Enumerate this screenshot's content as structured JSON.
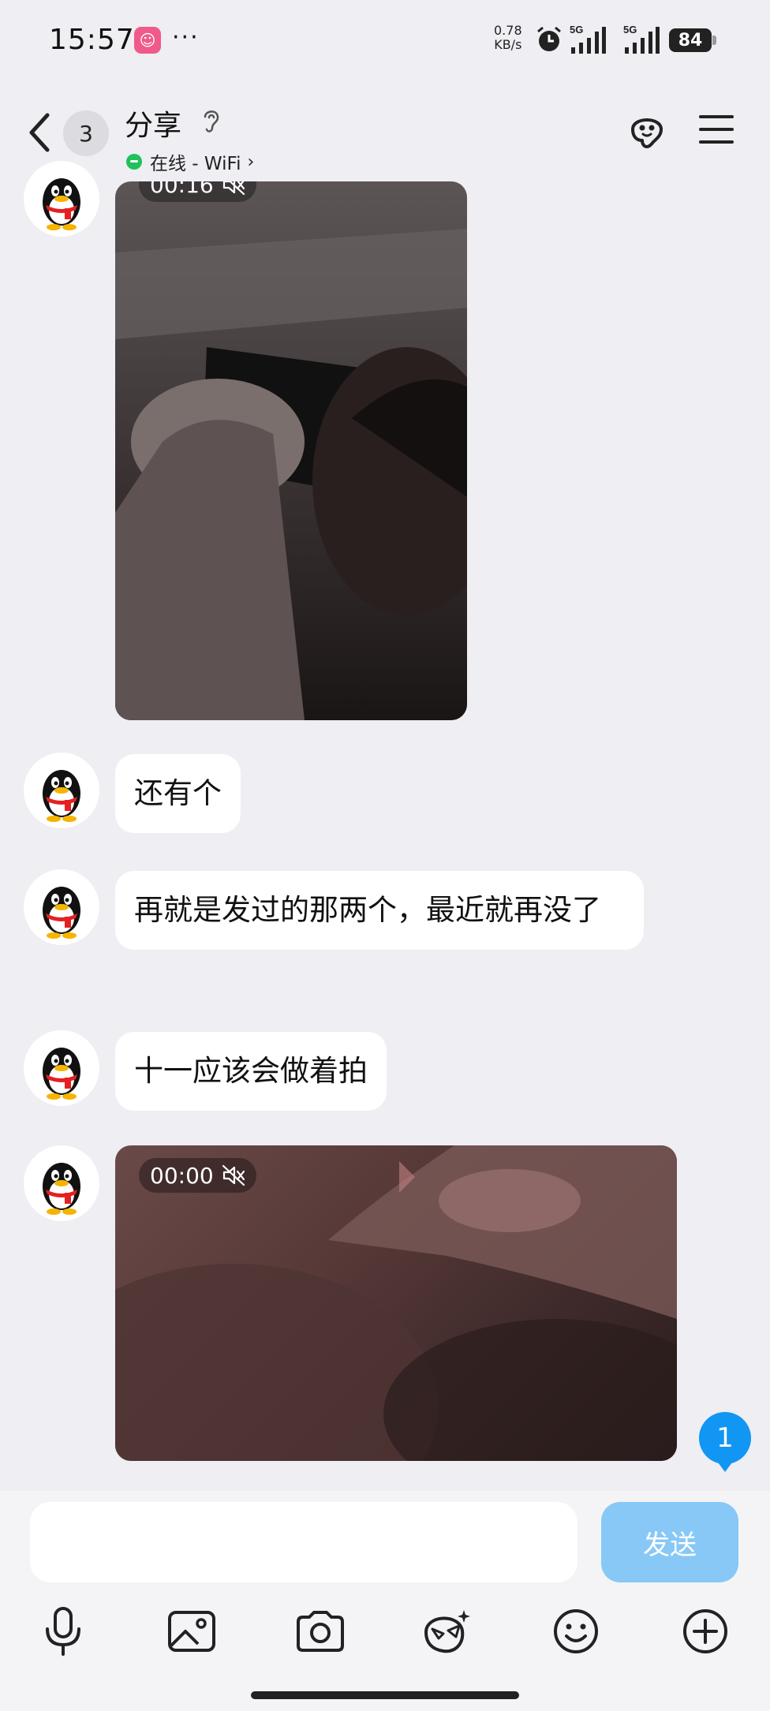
{
  "status_bar": {
    "time": "15:57",
    "app_badge_glyph": "☺",
    "more": "···",
    "net_speed_value": "0.78",
    "net_speed_unit": "KB/s",
    "signal1_label": "5G",
    "signal2_label": "5G",
    "battery": "84"
  },
  "header": {
    "unread_count": "3",
    "title": "分享",
    "presence": "在线 - WiFi",
    "presence_chevron": "›"
  },
  "messages": [
    {
      "type": "video",
      "duration": "00:16",
      "muted": true
    },
    {
      "type": "text",
      "text": "还有个"
    },
    {
      "type": "text",
      "text": "再就是发过的那两个，最近就再没了"
    },
    {
      "type": "text",
      "text": "十一应该会做着拍"
    },
    {
      "type": "video",
      "duration": "00:00",
      "muted": true
    }
  ],
  "new_message_badge": "1",
  "input": {
    "value": "",
    "placeholder": "",
    "send_label": "发送"
  },
  "toolbar_icons": [
    "microphone-icon",
    "image-icon",
    "camera-icon",
    "sticker-icon",
    "emoji-icon",
    "plus-icon"
  ],
  "colors": {
    "background": "#eeeef3",
    "accent": "#1296f3",
    "send_button": "#87c8f7",
    "online": "#20c15b"
  }
}
